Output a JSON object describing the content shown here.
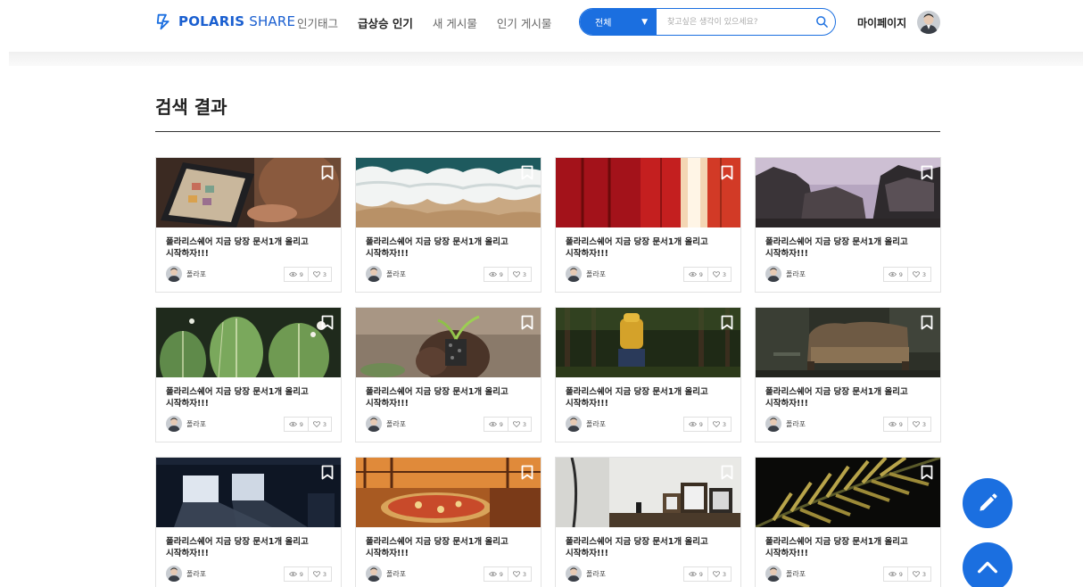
{
  "header": {
    "logo_text_bold": "POLARIS",
    "logo_text_light": " SHARE",
    "nav": [
      "인기태그",
      "급상승 인기",
      "새 게시물",
      "인기 게시물"
    ],
    "active_nav": 1,
    "search": {
      "category": "전체",
      "placeholder": "찾고싶은 생각이 있으세요?"
    },
    "mypage_label": "마이페이지"
  },
  "page_title": "검색 결과",
  "colors": {
    "accent": "#1b6fe0",
    "text": "#222222",
    "rule": "#333333"
  },
  "cards": [
    {
      "title": "폴라리스쉐어 지금 당장 문서1개 올리고 시작하자!!!",
      "author": "폴라포",
      "views": "9",
      "likes": "3",
      "image": "laptop-photo"
    },
    {
      "title": "폴라리스쉐어 지금 당장 문서1개 올리고 시작하자!!!",
      "author": "폴라포",
      "views": "9",
      "likes": "3",
      "image": "ocean-wave-photo"
    },
    {
      "title": "폴라리스쉐어 지금 당장 문서1개 올리고 시작하자!!!",
      "author": "폴라포",
      "views": "9",
      "likes": "3",
      "image": "red-containers-photo"
    },
    {
      "title": "폴라리스쉐어 지금 당장 문서1개 올리고 시작하자!!!",
      "author": "폴라포",
      "views": "9",
      "likes": "3",
      "image": "rocky-cliffs-photo"
    },
    {
      "title": "폴라리스쉐어 지금 당장 문서1개 올리고 시작하자!!!",
      "author": "폴라포",
      "views": "9",
      "likes": "3",
      "image": "cactus-photo"
    },
    {
      "title": "폴라리스쉐어 지금 당장 문서1개 올리고 시작하자!!!",
      "author": "폴라포",
      "views": "9",
      "likes": "3",
      "image": "seedling-hands-photo"
    },
    {
      "title": "폴라리스쉐어 지금 당장 문서1개 올리고 시작하자!!!",
      "author": "폴라포",
      "views": "9",
      "likes": "3",
      "image": "forest-hiker-photo"
    },
    {
      "title": "폴라리스쉐어 지금 당장 문서1개 올리고 시작하자!!!",
      "author": "폴라포",
      "views": "9",
      "likes": "3",
      "image": "old-sofa-photo"
    },
    {
      "title": "폴라리스쉐어 지금 당장 문서1개 올리고 시작하자!!!",
      "author": "폴라포",
      "views": "9",
      "likes": "3",
      "image": "dark-room-light-photo"
    },
    {
      "title": "폴라리스쉐어 지금 당장 문서1개 올리고 시작하자!!!",
      "author": "폴라포",
      "views": "9",
      "likes": "3",
      "image": "pizza-photo"
    },
    {
      "title": "폴라리스쉐어 지금 당장 문서1개 올리고 시작하자!!!",
      "author": "폴라포",
      "views": "9",
      "likes": "3",
      "image": "photo-frames-photo"
    },
    {
      "title": "폴라리스쉐어 지금 당장 문서1개 올리고 시작하자!!!",
      "author": "폴라포",
      "views": "9",
      "likes": "3",
      "image": "palm-leaves-photo"
    }
  ]
}
